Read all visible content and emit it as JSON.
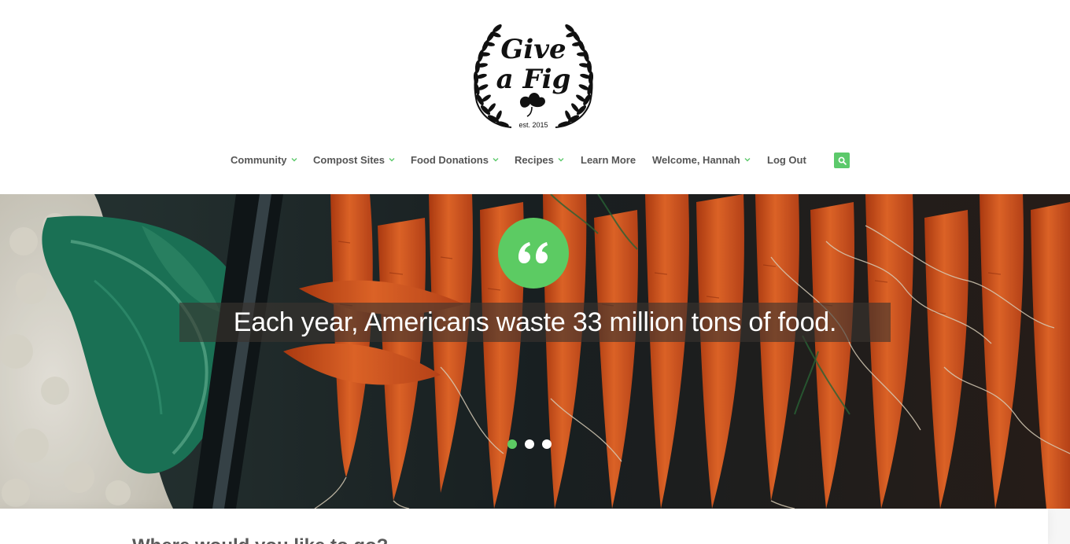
{
  "brand": {
    "logo_line1": "Give",
    "logo_line2": "a Fig",
    "logo_est": "est. 2015"
  },
  "nav": {
    "items": [
      {
        "label": "Community",
        "has_dropdown": true
      },
      {
        "label": "Compost Sites",
        "has_dropdown": true
      },
      {
        "label": "Food Donations",
        "has_dropdown": true
      },
      {
        "label": "Recipes",
        "has_dropdown": true
      },
      {
        "label": "Learn More",
        "has_dropdown": false
      },
      {
        "label": "Welcome, Hannah",
        "has_dropdown": true
      },
      {
        "label": "Log Out",
        "has_dropdown": false
      }
    ],
    "search_icon": "search-icon",
    "dropdown_icon": "chevron-down-icon"
  },
  "hero": {
    "quote_icon": "quote-icon",
    "quote": "Each year, Americans waste 33 million tons of food.",
    "slides": 3,
    "active_slide": 1
  },
  "section": {
    "heading": "Where would you like to go?"
  },
  "colors": {
    "accent": "#5ccb63",
    "nav_text": "#555555",
    "carrot": "#d9551f",
    "background": "#ffffff"
  }
}
